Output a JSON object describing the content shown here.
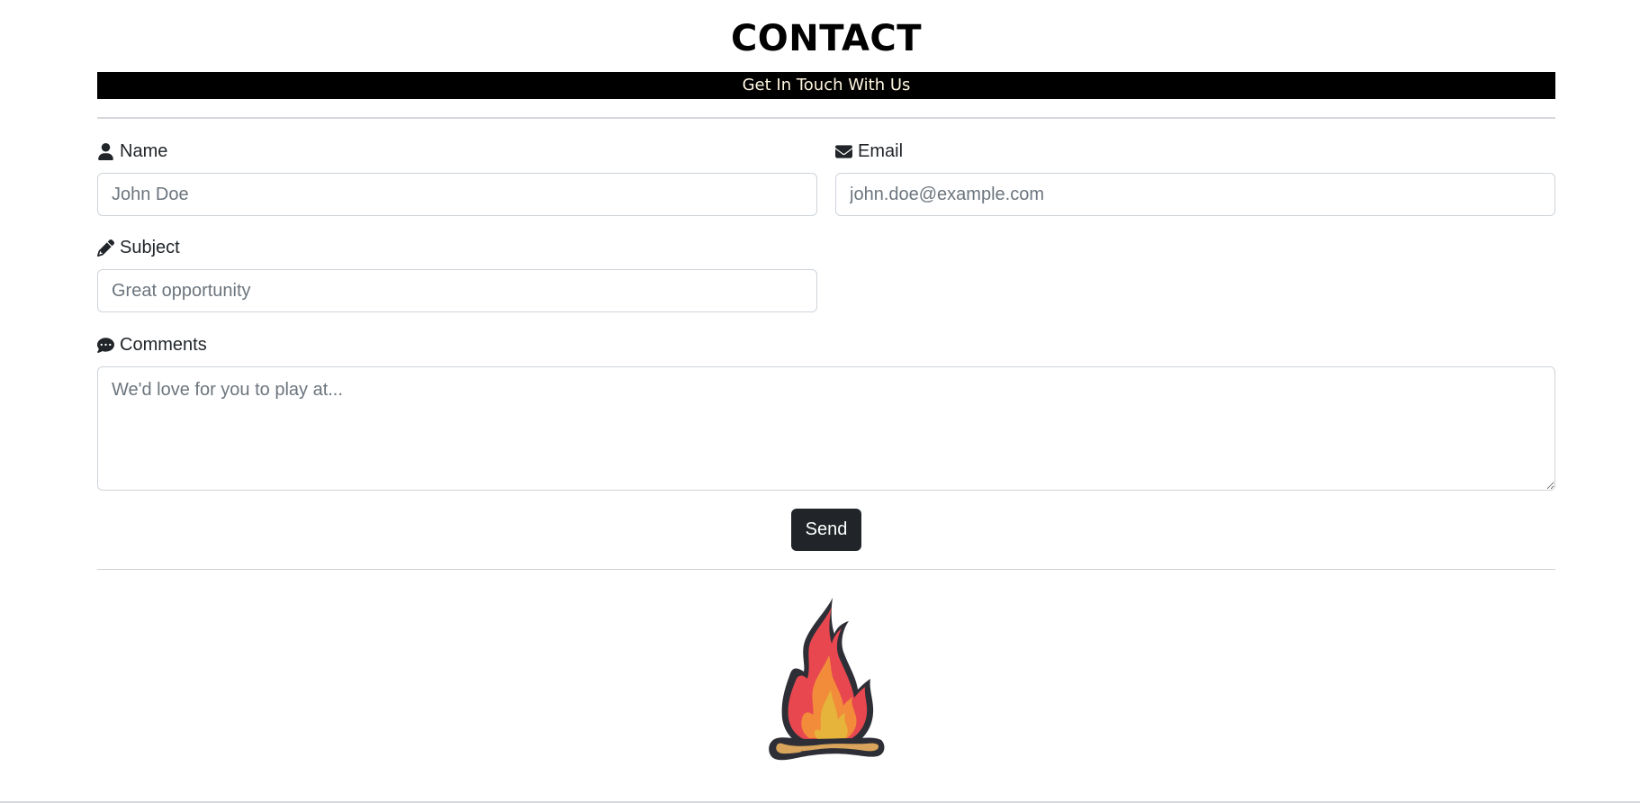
{
  "header": {
    "title": "CONTACT",
    "subtitle": "Get In Touch With Us"
  },
  "form": {
    "name": {
      "label": "Name",
      "placeholder": "John Doe",
      "icon": "user-icon"
    },
    "email": {
      "label": "Email",
      "placeholder": "john.doe@example.com",
      "icon": "envelope-icon"
    },
    "subject": {
      "label": "Subject",
      "placeholder": "Great opportunity",
      "icon": "pencil-icon"
    },
    "comments": {
      "label": "Comments",
      "placeholder": "We'd love for you to play at...",
      "icon": "comment-dots-icon"
    },
    "send_label": "Send"
  },
  "footer": {
    "logo": "campfire-logo"
  },
  "colors": {
    "banner_bg": "#000000",
    "banner_text": "#fff6e0",
    "button_bg": "#212529",
    "flame_red": "#e8474f",
    "flame_orange": "#f28c3a",
    "flame_yellow": "#e6b43a",
    "log_tan": "#d9a45b",
    "outline": "#2e2f36"
  }
}
